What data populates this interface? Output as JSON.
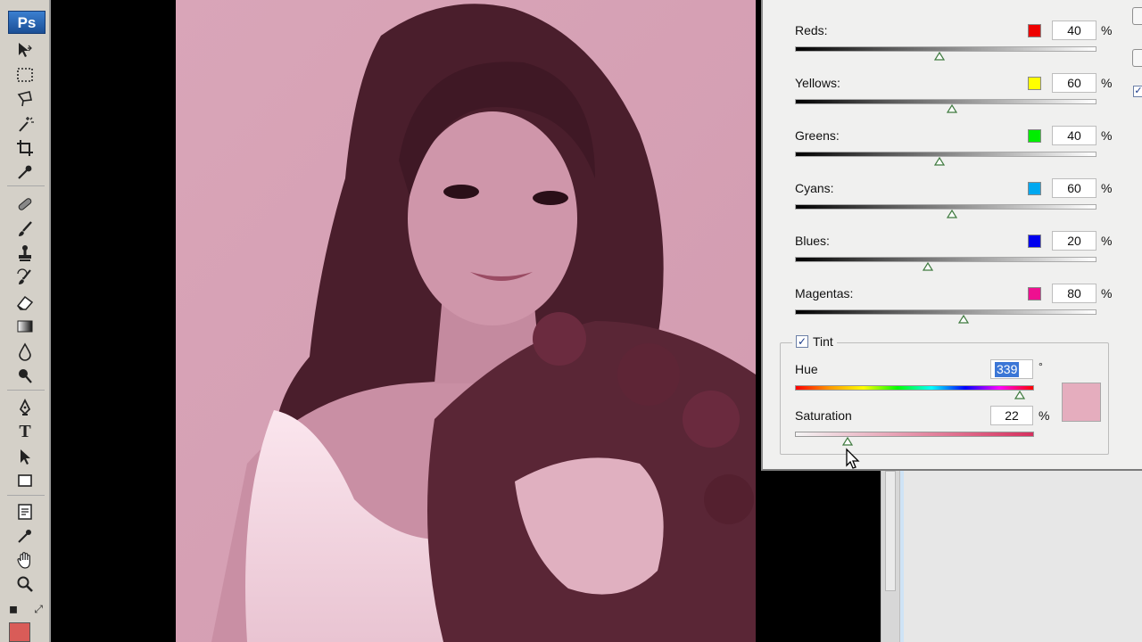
{
  "app": {
    "logo_text": "Ps",
    "foreground_color": "#d95c58"
  },
  "toolbox": {
    "tools": [
      {
        "name": "move-tool-icon"
      },
      {
        "name": "marquee-tool-icon"
      },
      {
        "name": "lasso-tool-icon"
      },
      {
        "name": "quick-select-tool-icon"
      },
      {
        "name": "crop-tool-icon"
      },
      {
        "name": "eyedropper-tool-icon"
      },
      {
        "name": "healing-brush-tool-icon"
      },
      {
        "name": "brush-tool-icon"
      },
      {
        "name": "clone-stamp-tool-icon"
      },
      {
        "name": "history-brush-tool-icon"
      },
      {
        "name": "eraser-tool-icon"
      },
      {
        "name": "gradient-tool-icon"
      },
      {
        "name": "blur-tool-icon"
      },
      {
        "name": "dodge-tool-icon"
      },
      {
        "name": "pen-tool-icon"
      },
      {
        "name": "type-tool-icon"
      },
      {
        "name": "path-selection-tool-icon"
      },
      {
        "name": "shape-tool-icon"
      },
      {
        "name": "notes-tool-icon"
      },
      {
        "name": "eyedropper-sample-tool-icon"
      },
      {
        "name": "hand-tool-icon"
      },
      {
        "name": "zoom-tool-icon"
      }
    ]
  },
  "dialog": {
    "channels": [
      {
        "label": "Reds:",
        "color": "#ee0000",
        "value": "40",
        "unit": "%",
        "level": 0.48
      },
      {
        "label": "Yellows:",
        "color": "#ffff00",
        "value": "60",
        "unit": "%",
        "level": 0.52
      },
      {
        "label": "Greens:",
        "color": "#00ee00",
        "value": "40",
        "unit": "%",
        "level": 0.48
      },
      {
        "label": "Cyans:",
        "color": "#00a8f0",
        "value": "60",
        "unit": "%",
        "level": 0.52
      },
      {
        "label": "Blues:",
        "color": "#0000ee",
        "value": "20",
        "unit": "%",
        "level": 0.44
      },
      {
        "label": "Magentas:",
        "color": "#ee1090",
        "value": "80",
        "unit": "%",
        "level": 0.56
      }
    ],
    "tint": {
      "checked": true,
      "label": "Tint",
      "hue_label": "Hue",
      "hue_value": "339",
      "hue_unit": "°",
      "hue_level": 0.94,
      "saturation_label": "Saturation",
      "saturation_value": "22",
      "saturation_unit": "%",
      "saturation_level": 0.22,
      "swatch_color": "#e5adbe"
    },
    "edge_checkbox_checked": true
  }
}
